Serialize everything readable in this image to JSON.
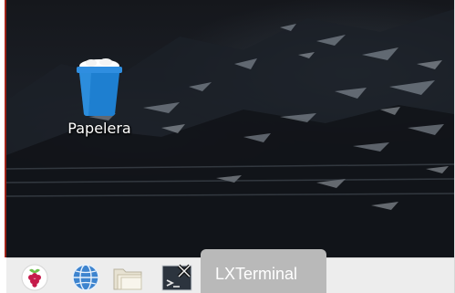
{
  "desktop": {
    "icons": [
      {
        "label": "Papelera",
        "icon": "trash-icon"
      }
    ]
  },
  "taskbar": {
    "launchers": [
      {
        "name": "menu",
        "icon": "raspberry-icon"
      },
      {
        "name": "browser",
        "icon": "globe-icon"
      },
      {
        "name": "files",
        "icon": "folder-icon"
      },
      {
        "name": "terminal",
        "icon": "terminal-icon"
      }
    ],
    "active_task": {
      "label": "LXTerminal"
    }
  },
  "colors": {
    "trash_blue": "#1e7fd0",
    "panel_bg": "#ededed",
    "tooltip_bg": "#b9b9b9",
    "raspberry_red": "#c51a4a",
    "leaf_green": "#6cc04a"
  }
}
